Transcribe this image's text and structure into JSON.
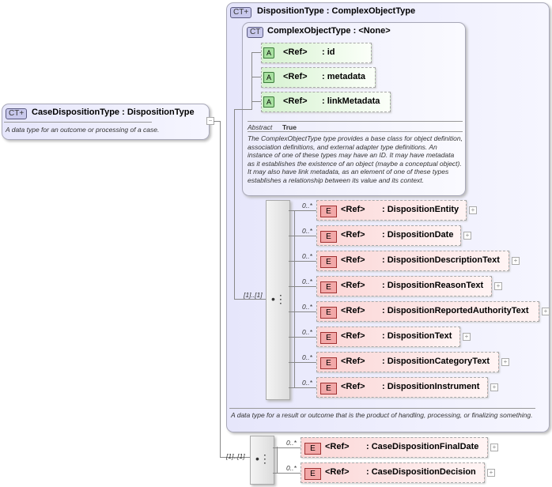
{
  "case_type": {
    "badge": "CT+",
    "title": "CaseDispositionType : DispositionType",
    "description": "A data type for an outcome or processing of a case."
  },
  "disposition_type": {
    "badge": "CT+",
    "title": "DispositionType : ComplexObjectType",
    "description": "A data type for a result or outcome that is the product of handling, processing, or finalizing something."
  },
  "complex_object_type": {
    "badge": "CT",
    "title": "ComplexObjectType : <None>",
    "attributes": [
      {
        "badge": "A",
        "ref": "<Ref>",
        "name": ": id"
      },
      {
        "badge": "A",
        "ref": "<Ref>",
        "name": ": metadata"
      },
      {
        "badge": "A",
        "ref": "<Ref>",
        "name": ": linkMetadata"
      }
    ],
    "abstract_label": "Abstract",
    "abstract_value": "True",
    "description": "The ComplexObjectType type provides a base class for object definition, association definitions, and external adapter type definitions. An instance of one of these types may have an ID. It may have metadata as it establishes the existence of an object (maybe a conceptual object). It may also have link metadata, as an element of one of these types establishes a relationship between its value and its context."
  },
  "sequence1": {
    "cardinality": "[1]..[1]",
    "elements": [
      {
        "card": "0..*",
        "badge": "E",
        "ref": "<Ref>",
        "name": ": DispositionEntity"
      },
      {
        "card": "0..*",
        "badge": "E",
        "ref": "<Ref>",
        "name": ": DispositionDate"
      },
      {
        "card": "0..*",
        "badge": "E",
        "ref": "<Ref>",
        "name": ": DispositionDescriptionText"
      },
      {
        "card": "0..*",
        "badge": "E",
        "ref": "<Ref>",
        "name": ": DispositionReasonText"
      },
      {
        "card": "0..*",
        "badge": "E",
        "ref": "<Ref>",
        "name": ": DispositionReportedAuthorityText"
      },
      {
        "card": "0..*",
        "badge": "E",
        "ref": "<Ref>",
        "name": ": DispositionText"
      },
      {
        "card": "0..*",
        "badge": "E",
        "ref": "<Ref>",
        "name": ": DispositionCategoryText"
      },
      {
        "card": "0..*",
        "badge": "E",
        "ref": "<Ref>",
        "name": ": DispositionInstrument"
      }
    ]
  },
  "sequence2": {
    "cardinality": "[1]..[1]",
    "elements": [
      {
        "card": "0..*",
        "badge": "E",
        "ref": "<Ref>",
        "name": ": CaseDispositionFinalDate"
      },
      {
        "card": "0..*",
        "badge": "E",
        "ref": "<Ref>",
        "name": ": CaseDispositionDecision"
      }
    ]
  }
}
